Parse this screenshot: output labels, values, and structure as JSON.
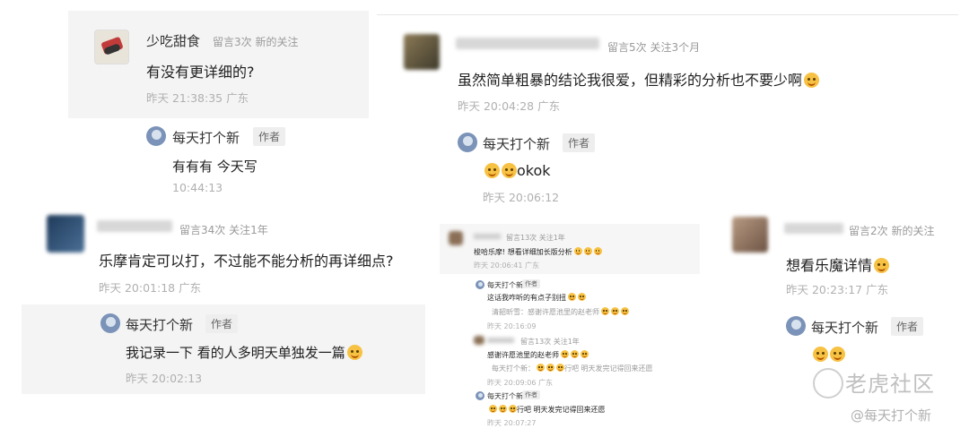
{
  "c1": {
    "name": "少吃甜食",
    "meta": "留言3次 新的关注",
    "text": "有没有更详细的?",
    "time": "昨天 21:38:35 广东"
  },
  "r1": {
    "name": "每天打个新",
    "badge": "作者",
    "text": "有有有 今天写",
    "time": "10:44:13"
  },
  "c2": {
    "meta": "留言34次 关注1年",
    "text": "乐摩肯定可以打，不过能不能分析的再详细点?",
    "time": "昨天 20:01:18 广东"
  },
  "r2": {
    "name": "每天打个新",
    "badge": "作者",
    "text": "我记录一下 看的人多明天单独发一篇",
    "time": "昨天 20:02:13"
  },
  "c3": {
    "meta": "留言5次 关注3个月",
    "text": "虽然简单粗暴的结论我很爱，但精彩的分析也不要少啊",
    "time": "昨天 20:04:28 广东"
  },
  "r3": {
    "name": "每天打个新",
    "badge": "作者",
    "text": "okok",
    "time": "昨天 20:06:12"
  },
  "small": {
    "c_meta": "留言13次 关注1年",
    "c_text": "梭哈乐摩! 想看详细加长版分析",
    "c_time": "昨天 20:06:41 广东",
    "r1_name": "每天打个新",
    "r1_badge": "作者",
    "r1_text": "这话我咋听的有点子别扭",
    "r1_quote": "清韶昕雪：感谢许愿池里的赵老师",
    "r1_time": "昨天 20:16:09",
    "c2_meta": "留言13次 关注1年",
    "c2_text": "感谢许愿池里的赵老师",
    "c2_quote": "每天打个新：",
    "c2_quote2": "行吧 明天发完记得回来还愿",
    "c2_time": "昨天 20:09:06 广东",
    "r2_name": "每天打个新",
    "r2_badge": "作者",
    "r2_text": "行吧 明天发完记得回来还愿",
    "r2_time": "昨天 20:07:27"
  },
  "c4": {
    "meta": "留言2次 新的关注",
    "text": "想看乐魔详情",
    "time": "昨天 20:23:17 广东"
  },
  "r4": {
    "name": "每天打个新",
    "badge": "作者"
  },
  "watermark": {
    "site": "老虎社区",
    "handle": "@每天打个新"
  }
}
